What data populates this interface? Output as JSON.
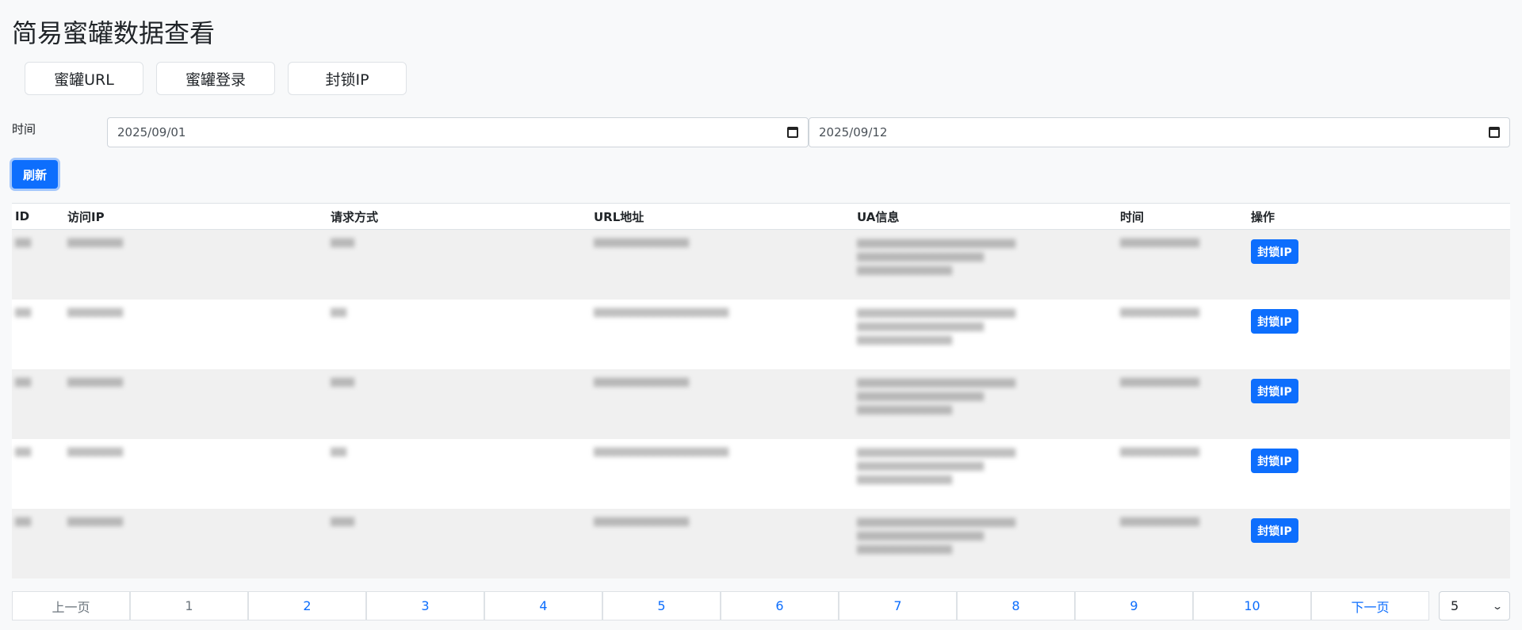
{
  "page_title": "简易蜜罐数据查看",
  "nav": {
    "honeypot_url": "蜜罐URL",
    "honeypot_login": "蜜罐登录",
    "block_ip": "封锁IP"
  },
  "filter": {
    "time_label": "时间",
    "start_date": "2025/09/01",
    "end_date": "2025/09/12",
    "refresh_label": "刷新"
  },
  "table": {
    "headers": [
      "ID",
      "访问IP",
      "请求方式",
      "URL地址",
      "UA信息",
      "时间",
      "操作"
    ],
    "action_label": "封锁IP"
  },
  "pagination": {
    "prev": "上一页",
    "pages": [
      "1",
      "2",
      "3",
      "4",
      "5",
      "6",
      "7",
      "8",
      "9",
      "10"
    ],
    "next": "下一页",
    "page_size": "5"
  }
}
